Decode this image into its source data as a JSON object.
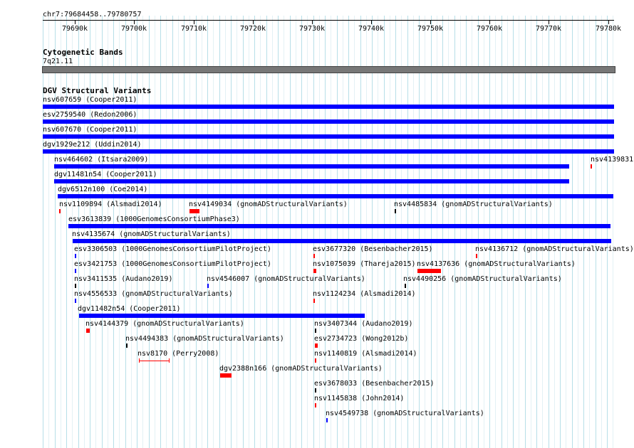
{
  "ruler": {
    "location": "chr7:79684458..79780757",
    "ticks": [
      "79690k",
      "79700k",
      "79710k",
      "79720k",
      "79730k",
      "79740k",
      "79750k",
      "79760k",
      "79770k",
      "79780k"
    ]
  },
  "cytoband": {
    "title": "Cytogenetic Bands",
    "band": "7q21.11"
  },
  "dgv": {
    "title": "DGV Structural Variants",
    "features": [
      {
        "label": "nsv607659 (Cooper2011)",
        "color": "#0000ff"
      },
      {
        "label": "esv2759540 (Redon2006)",
        "color": "#0000ff"
      },
      {
        "label": "nsv607670 (Cooper2011)",
        "color": "#0000ff"
      },
      {
        "label": "dgv1929e212 (Uddin2014)",
        "color": "#0000ff"
      },
      {
        "label": "",
        "color": "#0000ff"
      },
      {
        "label": "nsv464602 (Itsara2009)",
        "color": "#0000ff"
      },
      {
        "label": "nsv4139831",
        "color": "#ff0000"
      },
      {
        "label": "dgv11481n54 (Cooper2011)",
        "color": "#0000ff"
      },
      {
        "label": "",
        "color": "#0000ff"
      },
      {
        "label": "dgv6512n100 (Coe2014)",
        "color": "#0000ff"
      },
      {
        "label": "nsv1109894 (Alsmadi2014)",
        "color": "#ff0000"
      },
      {
        "label": "nsv4149034 (gnomADStructuralVariants)",
        "color": "#ff0000"
      },
      {
        "label": "nsv4485834 (gnomADStructuralVariants)",
        "color": "#000000"
      },
      {
        "label": "esv3613839 (1000GenomesConsortiumPhase3)",
        "color": "#0000ff"
      },
      {
        "label": "nsv4135674 (gnomADStructuralVariants)",
        "color": "#0000ff"
      },
      {
        "label": "esv3306503 (1000GenomesConsortiumPilotProject)",
        "color": "#0000ff"
      },
      {
        "label": "esv3677320 (Besenbacher2015)",
        "color": "#ff0000"
      },
      {
        "label": "nsv4136712 (gnomADStructuralVariants)",
        "color": "#ff0000"
      },
      {
        "label": "esv3421753 (1000GenomesConsortiumPilotProject)",
        "color": "#0000ff"
      },
      {
        "label": "nsv1075039 (Thareja2015)",
        "color": "#ff0000"
      },
      {
        "label": "nsv4137636 (gnomADStructuralVariants)",
        "color": "#ff0000"
      },
      {
        "label": "nsv3411535 (Audano2019)",
        "color": "#000000"
      },
      {
        "label": "nsv4546007 (gnomADStructuralVariants)",
        "color": "#0000ff"
      },
      {
        "label": "nsv4490256 (gnomADStructuralVariants)",
        "color": "#000000"
      },
      {
        "label": "nsv4556533 (gnomADStructuralVariants)",
        "color": "#0000ff"
      },
      {
        "label": "nsv1124234 (Alsmadi2014)",
        "color": "#ff0000"
      },
      {
        "label": "dgv11482n54 (Cooper2011)",
        "color": "#0000ff"
      },
      {
        "label": "nsv4144379 (gnomADStructuralVariants)",
        "color": "#ff0000"
      },
      {
        "label": "nsv3407344 (Audano2019)",
        "color": "#000000"
      },
      {
        "label": "nsv4494383 (gnomADStructuralVariants)",
        "color": "#000000"
      },
      {
        "label": "esv2734723 (Wong2012b)",
        "color": "#ff0000"
      },
      {
        "label": "nsv8170 (Perry2008)",
        "color": "#ff0000"
      },
      {
        "label": "nsv1140819 (Alsmadi2014)",
        "color": "#ff0000"
      },
      {
        "label": "dgv2388n166 (gnomADStructuralVariants)",
        "color": "#ff0000"
      },
      {
        "label": "esv3678033 (Besenbacher2015)",
        "color": "#000000"
      },
      {
        "label": "nsv1145838 (John2014)",
        "color": "#ff0000"
      },
      {
        "label": "nsv4549738 (gnomADStructuralVariants)",
        "color": "#0000ff"
      }
    ]
  }
}
